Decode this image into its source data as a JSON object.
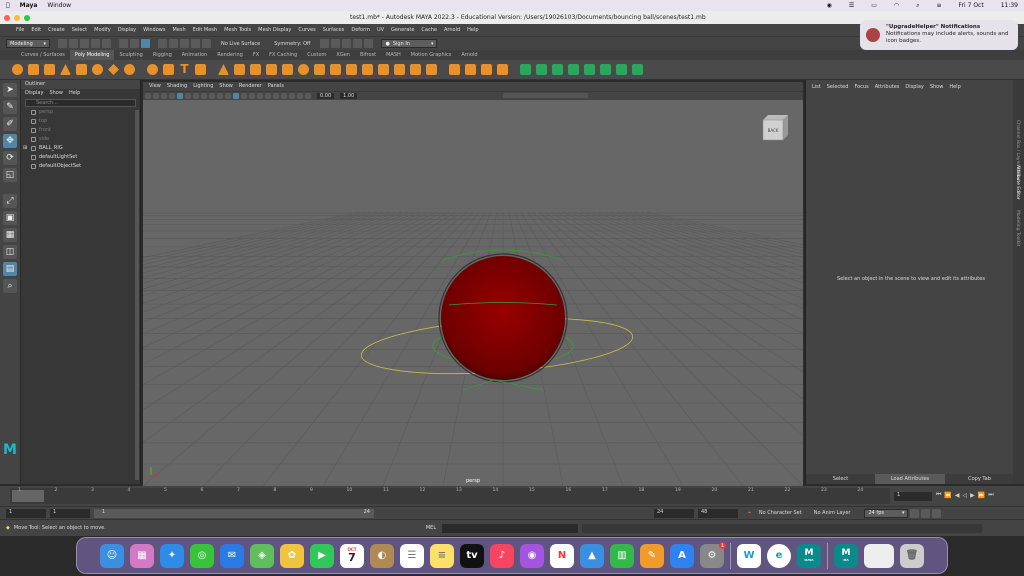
{
  "mac": {
    "app": "Maya",
    "window": "Window",
    "date": "Fri 7 Oct",
    "time": "11:39"
  },
  "window_title": "test1.mb* - Autodesk MAYA 2022.3 - Educational Version: /Users/19026103/Documents/bouncing ball/scenes/test1.mb",
  "menus": [
    "File",
    "Edit",
    "Create",
    "Select",
    "Modify",
    "Display",
    "Windows",
    "Mesh",
    "Edit Mesh",
    "Mesh Tools",
    "Mesh Display",
    "Curves",
    "Surfaces",
    "Deform",
    "UV",
    "Generate",
    "Cache",
    "Arnold",
    "Help"
  ],
  "status": {
    "mode": "Modeling",
    "live": "No Live Surface",
    "symmetry": "Symmetry: Off",
    "signin": "Sign In"
  },
  "shelf_tabs": [
    "Curves / Surfaces",
    "Poly Modeling",
    "Sculpting",
    "Rigging",
    "Animation",
    "Rendering",
    "FX",
    "FX Caching",
    "Custom",
    "XGen",
    "Bifrost",
    "MASH",
    "Motion Graphics",
    "Arnold"
  ],
  "shelf_active": "Poly Modeling",
  "outliner": {
    "title": "Outliner",
    "menus": [
      "Display",
      "Show",
      "Help"
    ],
    "search": "Search...",
    "items": [
      {
        "label": "persp",
        "dim": true
      },
      {
        "label": "top",
        "dim": true
      },
      {
        "label": "front",
        "dim": true
      },
      {
        "label": "side",
        "dim": true
      },
      {
        "label": "BALL_RIG",
        "dim": false
      },
      {
        "label": "defaultLightSet",
        "dim": false
      },
      {
        "label": "defaultObjectSet",
        "dim": false
      }
    ]
  },
  "viewport": {
    "menus": [
      "View",
      "Shading",
      "Lighting",
      "Show",
      "Renderer",
      "Panels"
    ],
    "val1": "0.00",
    "val2": "1.00",
    "camera": "persp",
    "cube_label": "BACK",
    "colors": {
      "ball": "#8a0000",
      "ring": "#c8c040",
      "ctrl": "#3a9a3a"
    }
  },
  "attr": {
    "menus": [
      "List",
      "Selected",
      "Focus",
      "Attributes",
      "Display",
      "Show",
      "Help"
    ],
    "message": "Select an object in the scene to view and edit its attributes",
    "select": "Select",
    "load": "Load Attributes",
    "copy": "Copy Tab"
  },
  "sidetabs": [
    "Channel Box / Layer Editor",
    "Attribute Editor",
    "Modeling Toolkit"
  ],
  "timeline": {
    "ticks": [
      "1",
      "2",
      "3",
      "4",
      "5",
      "6",
      "7",
      "8",
      "9",
      "10",
      "11",
      "12",
      "13",
      "14",
      "15",
      "16",
      "17",
      "18",
      "19",
      "20",
      "21",
      "22",
      "23",
      "24"
    ],
    "current": "1"
  },
  "range": {
    "start": "1",
    "start2": "1",
    "mid": "1",
    "end": "24",
    "end2": "24",
    "end3": "48",
    "char": "No Character Set",
    "anim": "No Anim Layer",
    "fps": "24 fps"
  },
  "help": {
    "text": "Move Tool: Select an object to move.",
    "mel": "MEL"
  },
  "notification": {
    "title": "\"UpgradeHelper\" Notifications",
    "body": "Notifications may include alerts, sounds and icon badges."
  },
  "dock": {
    "calendar_month": "OCT",
    "calendar_day": "7",
    "maya": "MAYA",
    "ma": "MA",
    "badge": "1"
  }
}
